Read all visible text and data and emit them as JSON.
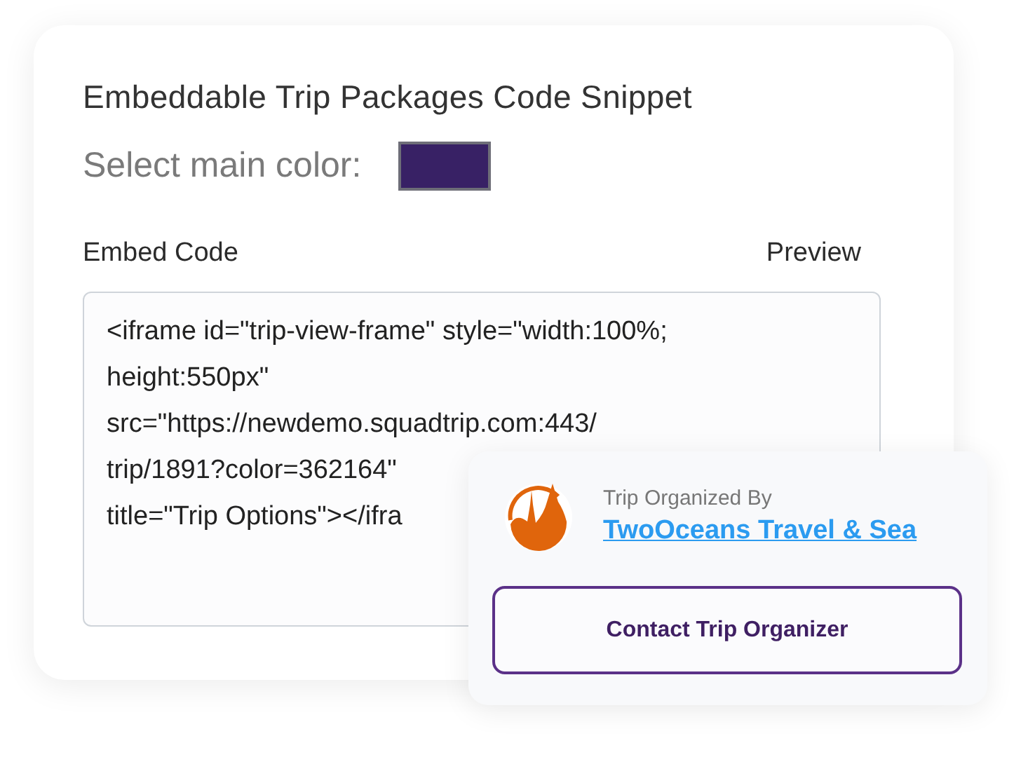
{
  "title": "Embeddable Trip Packages Code Snippet",
  "color_picker": {
    "label": "Select main color:",
    "color": "#382165"
  },
  "section_labels": [
    "Embed Code",
    "Preview"
  ],
  "code_lines": [
    "<iframe id=\"trip-view-frame\" style=\"width:100%;",
    "height:550px\"",
    "src=\"https://newdemo.squadtrip.com:443/",
    "trip/1891?color=362164\"",
    "title=\"Trip Options\"></ifra"
  ],
  "organizer": {
    "caption": "Trip Organized By",
    "name": "TwoOceans Travel & Sea",
    "button": "Contact Trip Organizer"
  }
}
